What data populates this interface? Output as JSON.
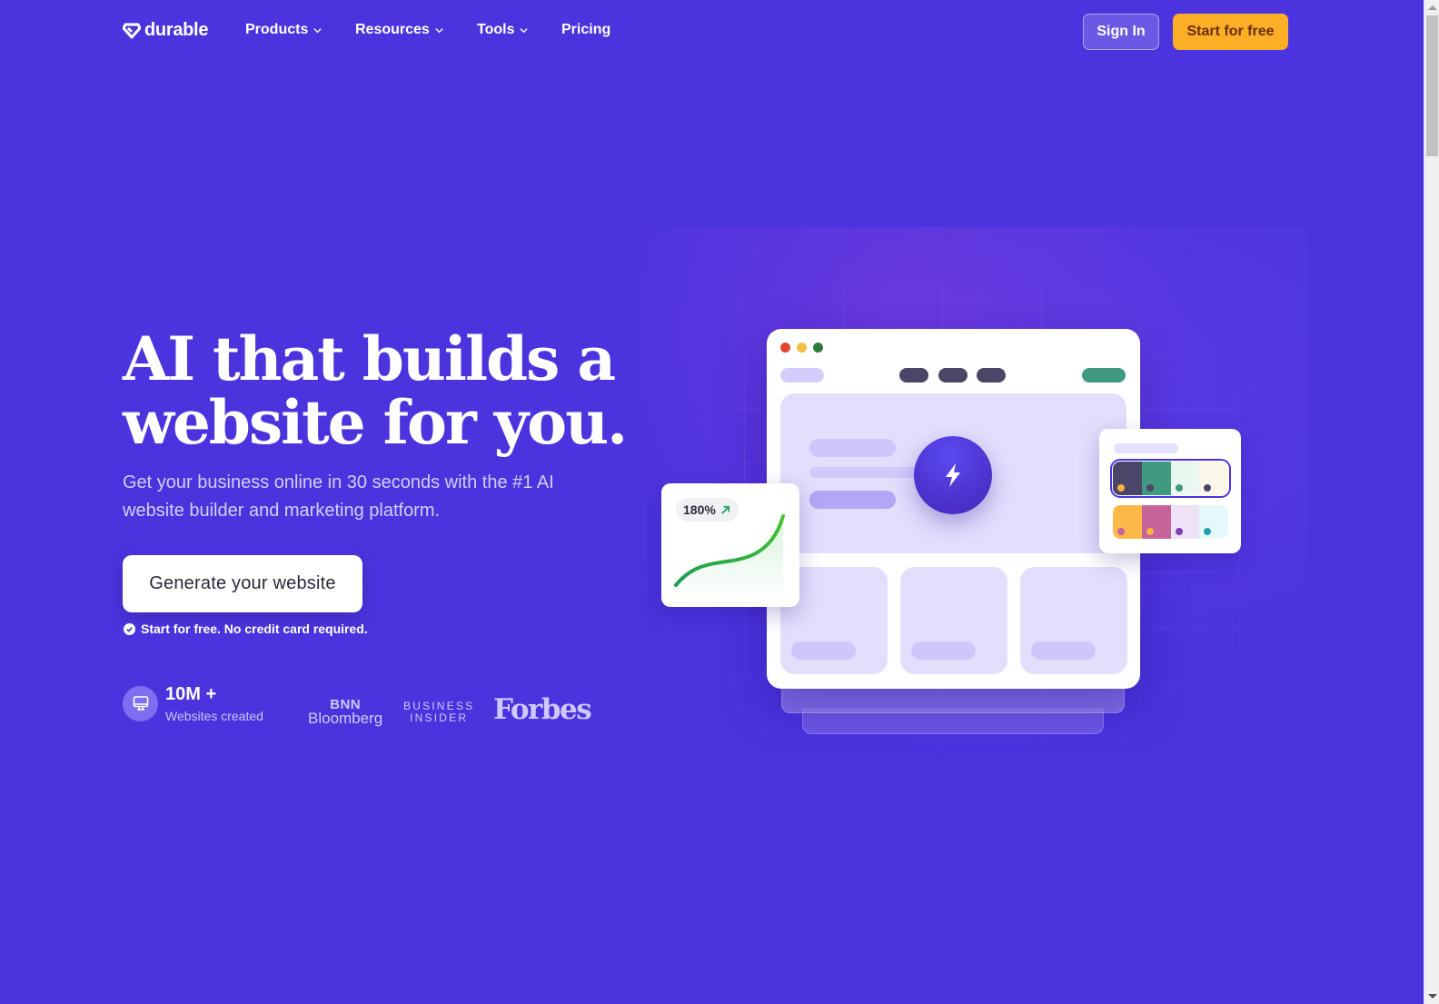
{
  "nav": {
    "logo_text": "durable",
    "items": [
      {
        "label": "Products",
        "has_dropdown": true
      },
      {
        "label": "Resources",
        "has_dropdown": true
      },
      {
        "label": "Tools",
        "has_dropdown": true
      },
      {
        "label": "Pricing",
        "has_dropdown": false
      }
    ],
    "sign_in_label": "Sign In",
    "start_label": "Start for free"
  },
  "hero": {
    "headline_line1": "AI that builds a",
    "headline_line2": "website for you.",
    "subhead": "Get your business online in 30 seconds with the #1 AI website builder and marketing platform.",
    "cta_label": "Generate your website",
    "note": "Start for free. No credit card required."
  },
  "stats": {
    "count": "10M +",
    "label": "Websites created",
    "icon": "monitor-icon"
  },
  "press": {
    "bnn_top": "BNN",
    "bnn_bottom": "Bloomberg",
    "bi_top": "BUSINESS",
    "bi_bottom": "INSIDER",
    "forbes": "Forbes"
  },
  "illustration": {
    "growth_badge": "180%",
    "growth_icon": "arrow-up-right-icon",
    "center_icon": "lightning-bolt-icon",
    "palettes": [
      {
        "selected": true,
        "colors": [
          "#4a4668",
          "#3f9a80",
          "#eaf6f0",
          "#fbf7ea"
        ],
        "dots": [
          "#fcb23e",
          "#4a4668",
          "#3f9a80",
          "#4a4668"
        ]
      },
      {
        "selected": false,
        "colors": [
          "#fcb949",
          "#c4649a",
          "#eee2f6",
          "#e6f9fa"
        ],
        "dots": [
          "#c4649a",
          "#fcb23e",
          "#7b3db8",
          "#1fa0ab"
        ]
      }
    ],
    "colors": {
      "brand_bg": "#4b34de",
      "cta_orange": "#fcaf26",
      "accent_green": "#3f9a80",
      "dark_pill": "#4a4668"
    }
  }
}
